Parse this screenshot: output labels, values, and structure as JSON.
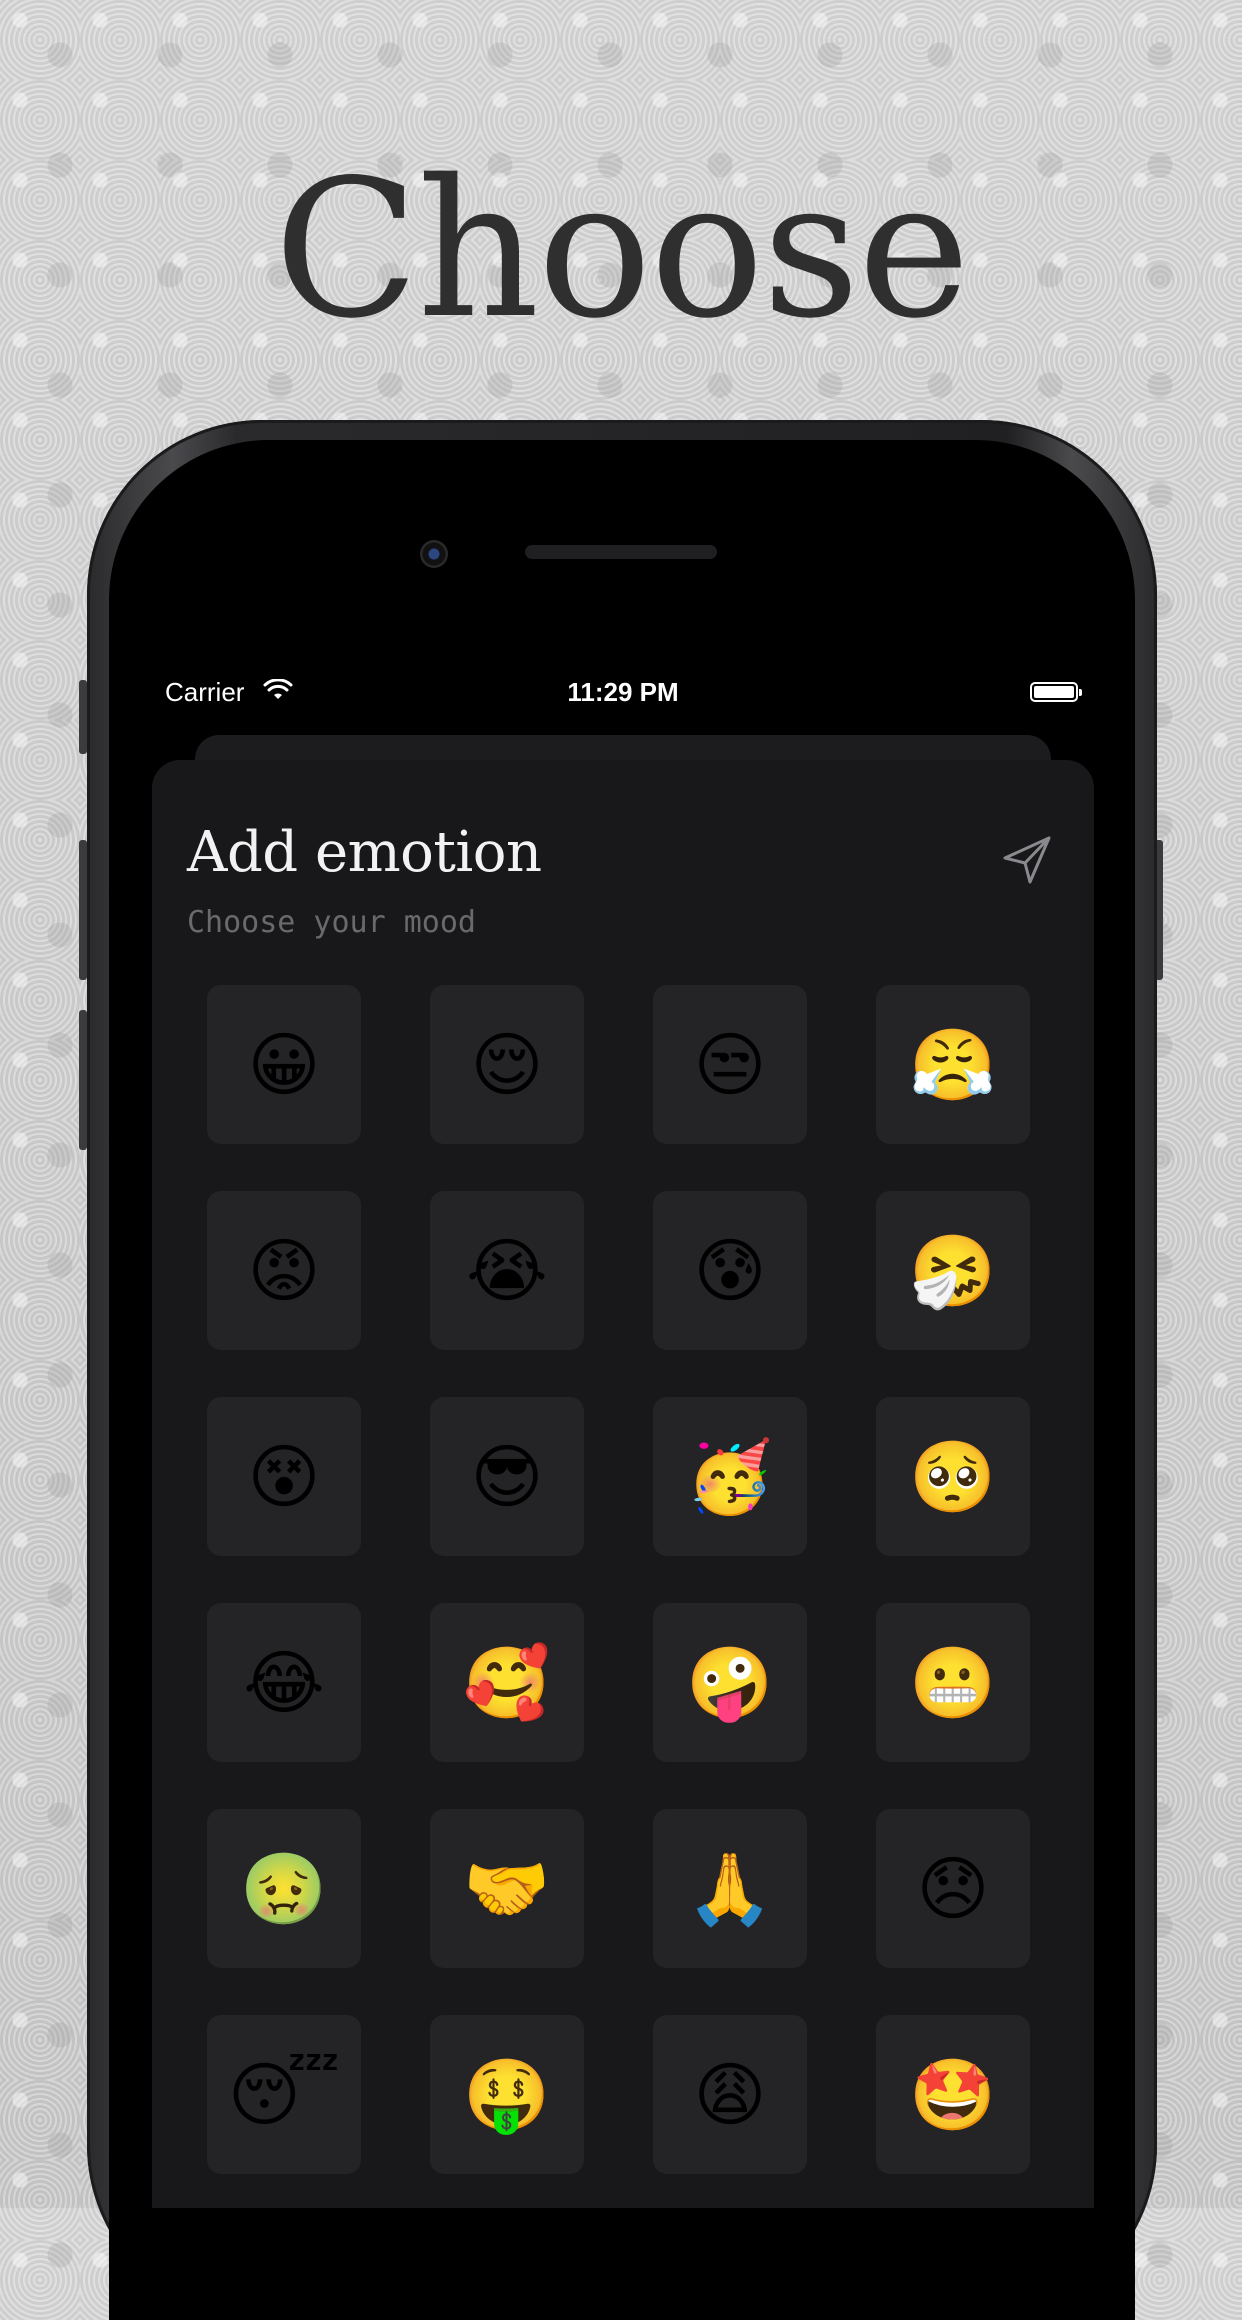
{
  "headline": "Choose",
  "status_bar": {
    "carrier": "Carrier",
    "time": "11:29 PM"
  },
  "sheet": {
    "title": "Add emotion",
    "subtitle": "Choose your mood",
    "send_icon": "send-icon"
  },
  "emojis": [
    "😀",
    "😌",
    "😒",
    "😤",
    "😡",
    "😭",
    "😰",
    "🤧",
    "😵",
    "😎",
    "🥳",
    "🥺",
    "😂",
    "🥰",
    "🤪",
    "😬",
    "🤢",
    "🤝",
    "🙏",
    "😞",
    "😴",
    "🤑",
    "😩",
    "🤩"
  ]
}
